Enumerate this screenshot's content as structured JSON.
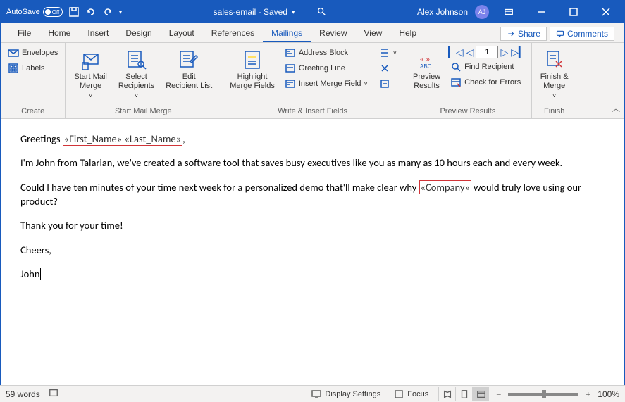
{
  "titlebar": {
    "autosave_label": "AutoSave",
    "autosave_state": "Off",
    "doc_title": "sales-email - Saved",
    "user_name": "Alex Johnson",
    "user_initials": "AJ"
  },
  "tabs": {
    "items": [
      {
        "label": "File"
      },
      {
        "label": "Home"
      },
      {
        "label": "Insert"
      },
      {
        "label": "Design"
      },
      {
        "label": "Layout"
      },
      {
        "label": "References"
      },
      {
        "label": "Mailings"
      },
      {
        "label": "Review"
      },
      {
        "label": "View"
      },
      {
        "label": "Help"
      }
    ],
    "active": "Mailings",
    "share_label": "Share",
    "comments_label": "Comments"
  },
  "ribbon": {
    "create": {
      "label": "Create",
      "envelopes": "Envelopes",
      "labels": "Labels"
    },
    "start": {
      "label": "Start Mail Merge",
      "start": "Start Mail\nMerge",
      "select": "Select\nRecipients",
      "edit": "Edit\nRecipient List"
    },
    "write": {
      "label": "Write & Insert Fields",
      "highlight": "Highlight\nMerge Fields",
      "address": "Address Block",
      "greeting": "Greeting Line",
      "insert": "Insert Merge Field"
    },
    "preview": {
      "label": "Preview Results",
      "preview": "Preview\nResults",
      "record": "1",
      "find": "Find Recipient",
      "check": "Check for Errors"
    },
    "finish": {
      "label": "Finish",
      "finish": "Finish &\nMerge"
    }
  },
  "document": {
    "p1_a": "Greetings ",
    "p1_field": "«First_Name» «Last_Name»",
    "p1_b": ",",
    "p2": "I'm John from Talarian, we've created a software tool that saves busy executives like you as many as 10 hours each and every week.",
    "p3_a": "Could I have ten minutes of your time next week for a personalized demo that'll make clear why ",
    "p3_field": "«Company»",
    "p3_b": " would truly love using our product?",
    "p4": "Thank you for your time!",
    "p5": "Cheers,",
    "p6": "John"
  },
  "statusbar": {
    "words": "59 words",
    "display": "Display Settings",
    "focus": "Focus",
    "zoom": "100%"
  }
}
